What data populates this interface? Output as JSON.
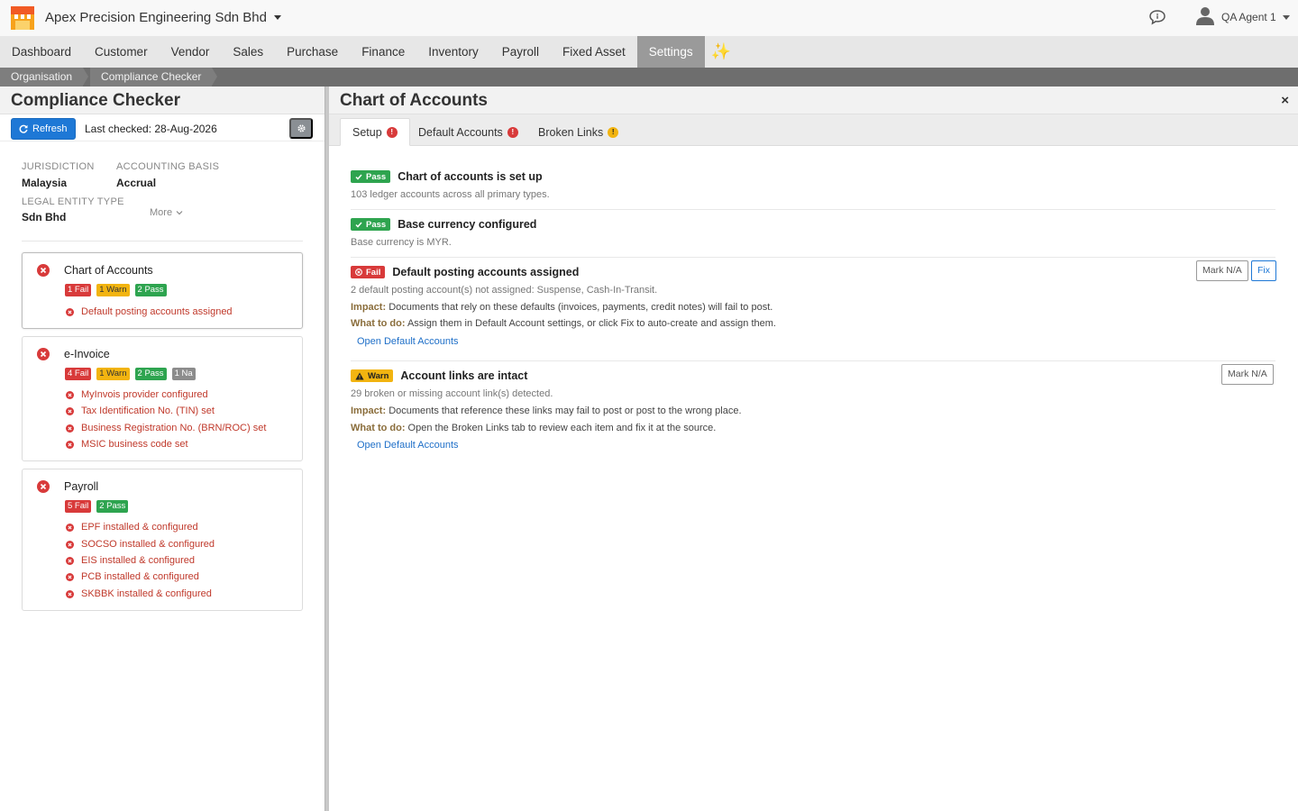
{
  "header": {
    "company": "Apex Precision Engineering Sdn Bhd",
    "user": "QA Agent 1"
  },
  "nav": [
    "Dashboard",
    "Customer",
    "Vendor",
    "Sales",
    "Purchase",
    "Finance",
    "Inventory",
    "Payroll",
    "Fixed Asset",
    "Settings"
  ],
  "nav_active": "Settings",
  "breadcrumb": [
    "Organisation",
    "Compliance Checker"
  ],
  "left": {
    "title": "Compliance Checker",
    "refresh_label": "Refresh",
    "last_checked": "Last checked: 28-Aug-2026",
    "jurisdiction_label": "JURISDICTION",
    "jurisdiction": "Malaysia",
    "basis_label": "ACCOUNTING BASIS",
    "basis": "Accrual",
    "entity_label": "LEGAL ENTITY TYPE",
    "entity": "Sdn Bhd",
    "more_label": "More",
    "cards": [
      {
        "title": "Chart of Accounts",
        "badges": [
          "1 Fail",
          "1 Warn",
          "2 Pass"
        ],
        "issues": [
          "Default posting accounts assigned"
        ]
      },
      {
        "title": "e-Invoice",
        "badges": [
          "4 Fail",
          "1 Warn",
          "2 Pass",
          "1 Na"
        ],
        "issues": [
          "MyInvois provider configured",
          "Tax Identification No. (TIN) set",
          "Business Registration No. (BRN/ROC) set",
          "MSIC business code set"
        ]
      },
      {
        "title": "Payroll",
        "badges": [
          "5 Fail",
          "2 Pass"
        ],
        "issues": [
          "EPF installed & configured",
          "SOCSO installed & configured",
          "EIS installed & configured",
          "PCB installed & configured",
          "SKBBK installed & configured"
        ]
      }
    ]
  },
  "right": {
    "title": "Chart of Accounts",
    "close": "×",
    "tabs": [
      {
        "label": "Setup",
        "badge": "!"
      },
      {
        "label": "Default Accounts",
        "badge": "!"
      },
      {
        "label": "Broken Links",
        "badge": "!"
      }
    ],
    "checks": [
      {
        "status": "Pass",
        "title": "Chart of accounts is set up",
        "desc": "103 ledger accounts across all primary types."
      },
      {
        "status": "Pass",
        "title": "Base currency configured",
        "desc": "Base currency is MYR."
      },
      {
        "status": "Fail",
        "title": "Default posting accounts assigned",
        "desc": "2 default posting account(s) not assigned: Suspense, Cash-In-Transit.",
        "impact_label": "Impact:",
        "impact": "Documents that rely on these defaults (invoices, payments, credit notes) will fail to post.",
        "todo_label": "What to do:",
        "todo": "Assign them in Default Account settings, or click Fix to auto-create and assign them.",
        "link": "Open Default Accounts",
        "na_label": "Mark N/A",
        "fix_label": "Fix"
      },
      {
        "status": "Warn",
        "title": "Account links are intact",
        "desc": "29 broken or missing account link(s) detected.",
        "impact_label": "Impact:",
        "impact": "Documents that reference these links may fail to post or post to the wrong place.",
        "todo_label": "What to do:",
        "todo": "Open the Broken Links tab to review each item and fix it at the source.",
        "link": "Open Default Accounts",
        "na_label": "Mark N/A"
      }
    ]
  },
  "colors": {
    "fail": "#d83a3a",
    "warn": "#f2b410",
    "pass": "#2ea44f",
    "na": "#8c8c8c",
    "primary": "#1e78d6"
  }
}
